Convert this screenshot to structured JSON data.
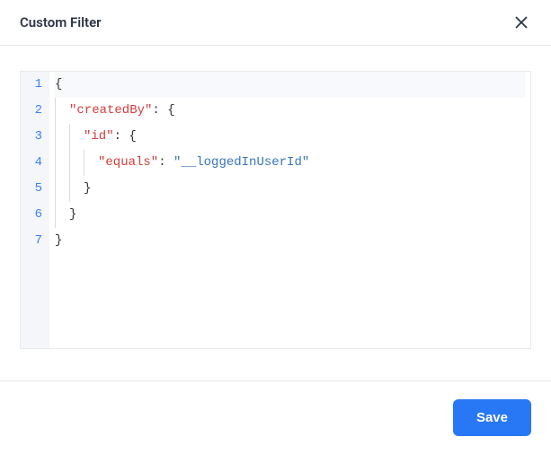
{
  "header": {
    "title": "Custom Filter"
  },
  "editor": {
    "gutter": [
      "1",
      "2",
      "3",
      "4",
      "5",
      "6",
      "7"
    ],
    "lines": [
      {
        "active": true,
        "indent": 0,
        "tokens": [
          {
            "cls": "tok-brace",
            "text": "{"
          }
        ]
      },
      {
        "active": false,
        "indent": 1,
        "tokens": [
          {
            "cls": "tok-key",
            "text": "\"createdBy\""
          },
          {
            "cls": "tok-punc",
            "text": ": "
          },
          {
            "cls": "tok-brace",
            "text": "{"
          }
        ]
      },
      {
        "active": false,
        "indent": 2,
        "tokens": [
          {
            "cls": "tok-key",
            "text": "\"id\""
          },
          {
            "cls": "tok-punc",
            "text": ": "
          },
          {
            "cls": "tok-brace",
            "text": "{"
          }
        ]
      },
      {
        "active": false,
        "indent": 3,
        "tokens": [
          {
            "cls": "tok-key",
            "text": "\"equals\""
          },
          {
            "cls": "tok-punc",
            "text": ": "
          },
          {
            "cls": "tok-str",
            "text": "\"__loggedInUserId\""
          }
        ]
      },
      {
        "active": false,
        "indent": 2,
        "tokens": [
          {
            "cls": "tok-brace",
            "text": "}"
          }
        ]
      },
      {
        "active": false,
        "indent": 1,
        "tokens": [
          {
            "cls": "tok-brace",
            "text": "}"
          }
        ]
      },
      {
        "active": false,
        "indent": 0,
        "tokens": [
          {
            "cls": "tok-brace",
            "text": "}"
          }
        ]
      }
    ]
  },
  "footer": {
    "save_label": "Save"
  }
}
